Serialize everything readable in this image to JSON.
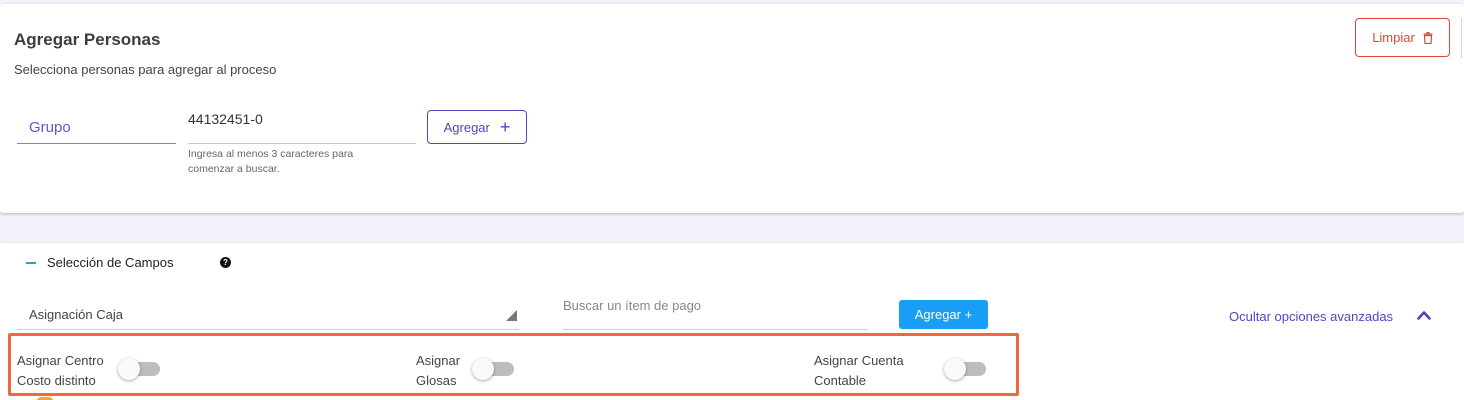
{
  "header": {
    "title": "Agregar Personas",
    "subtitle": "Selecciona personas para agregar al proceso",
    "clear_label": "Limpiar"
  },
  "person_form": {
    "group_select_value": "Grupo",
    "rut_value": "44132451-0",
    "hint": "Ingresa al menos 3 caracteres para comenzar a buscar.",
    "add_label": "Agregar",
    "add_icon": "+"
  },
  "fields_section": {
    "title": "Selección de Campos",
    "help_icon": "?",
    "caja_select_value": "Asignación Caja",
    "search_placeholder": "Buscar un ítem de pago",
    "add_label": "Agregar +",
    "advanced_link": "Ocultar opciones avanzadas",
    "toggles": [
      {
        "line1": "Asignar Centro",
        "line2": "Costo distinto",
        "on": false
      },
      {
        "line1": "Asignar",
        "line2": "Glosas",
        "on": false
      },
      {
        "line1": "Asignar Cuenta",
        "line2": "Contable",
        "on": false
      }
    ]
  },
  "colors": {
    "accent_purple": "#5b3fc4",
    "danger_red": "#e0453a",
    "primary_blue": "#1a9df5",
    "highlight_orange": "#f0683c"
  }
}
